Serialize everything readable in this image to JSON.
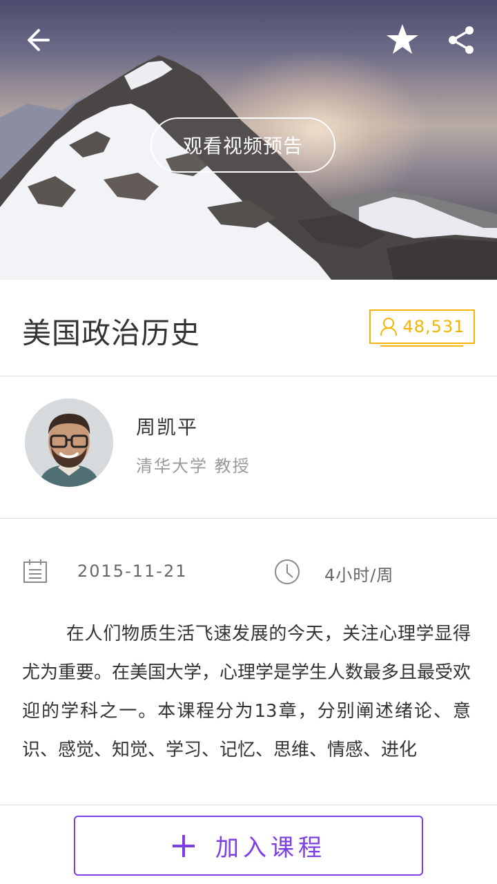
{
  "header": {
    "preview_label": "观看视频预告",
    "icons": [
      "back-arrow-icon",
      "star-icon",
      "share-icon"
    ]
  },
  "course": {
    "title": "美国政治历史",
    "learner_count": "48,531"
  },
  "teacher": {
    "name": "周凯平",
    "title": "清华大学 教授"
  },
  "meta": {
    "date": "2015-11-21",
    "hours": "4小时/周"
  },
  "description": "在人们物质生活飞速发展的今天，关注心理学显得尤为重要。在美国大学，心理学是学生人数最多且最受欢迎的学科之一。本课程分为13章，分别阐述绪论、意识、感觉、知觉、学习、记忆、思维、情感、进化",
  "actions": {
    "join_label": "加入课程"
  },
  "colors": {
    "accent_purple": "#7b3fe4",
    "badge_yellow": "#f4b400"
  }
}
